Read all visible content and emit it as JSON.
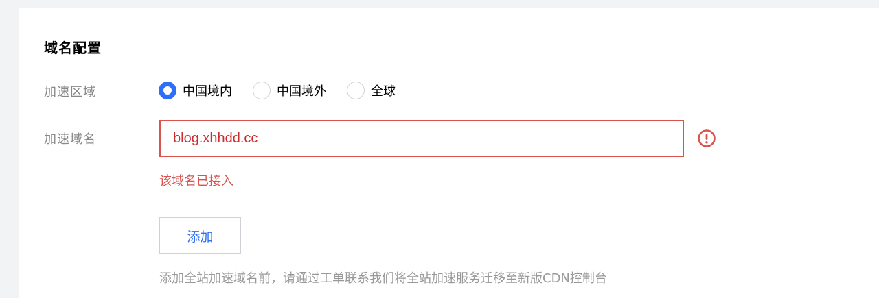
{
  "section": {
    "title": "域名配置"
  },
  "region": {
    "label": "加速区域",
    "options": [
      {
        "label": "中国境内",
        "checked": true
      },
      {
        "label": "中国境外",
        "checked": false
      },
      {
        "label": "全球",
        "checked": false
      }
    ]
  },
  "domain": {
    "label": "加速域名",
    "value": "blog.xhhdd.cc",
    "error_message": "该域名已接入",
    "error_icon": "exclamation-circle-icon"
  },
  "actions": {
    "add_label": "添加"
  },
  "hint": "添加全站加速域名前，请通过工单联系我们将全站加速服务迁移至新版CDN控制台",
  "colors": {
    "accent": "#2d6ff6",
    "error": "#d9534f",
    "muted": "#888888"
  }
}
